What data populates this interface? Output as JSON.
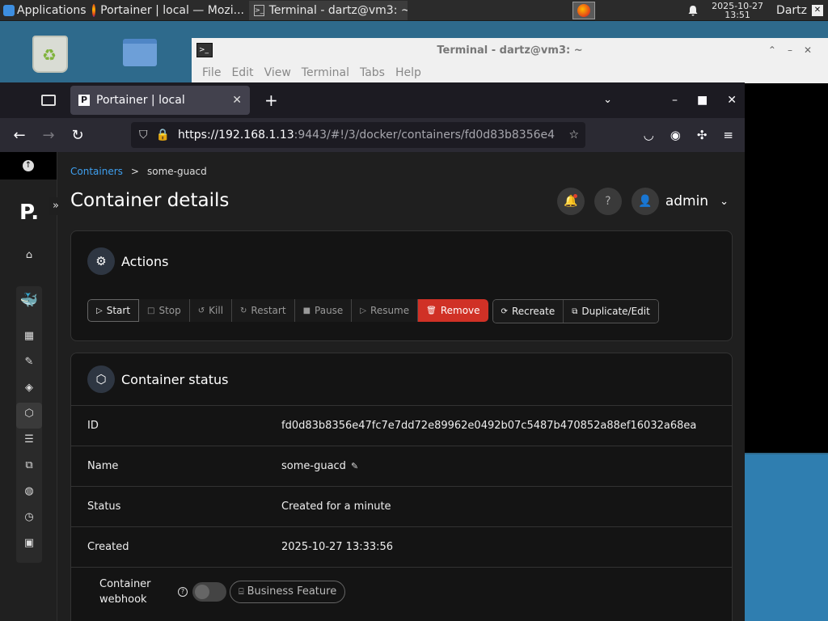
{
  "taskbar": {
    "apps_label": "Applications",
    "tasks": [
      {
        "label": "Portainer | local — Mozi..."
      },
      {
        "label": "Terminal - dartz@vm3: ~"
      }
    ],
    "clock_date": "2025-10-27",
    "clock_time": "13:51",
    "user": "Dartz"
  },
  "terminal": {
    "title": "Terminal - dartz@vm3: ~",
    "menu": [
      "File",
      "Edit",
      "View",
      "Terminal",
      "Tabs",
      "Help"
    ]
  },
  "browser": {
    "tab_title": "Portainer | local",
    "url_host": "https://192.168.1.13",
    "url_rest": ":9443/#!/3/docker/containers/fd0d83b8356e4"
  },
  "page": {
    "breadcrumb_link": "Containers",
    "breadcrumb_sep": ">",
    "breadcrumb_current": "some-guacd",
    "title": "Container details",
    "user": "admin"
  },
  "actions": {
    "title": "Actions",
    "group1": [
      {
        "label": "Start",
        "icon": "play-icon"
      },
      {
        "label": "Stop",
        "icon": "stop-icon"
      },
      {
        "label": "Kill",
        "icon": "kill-icon"
      },
      {
        "label": "Restart",
        "icon": "restart-icon"
      },
      {
        "label": "Pause",
        "icon": "pause-icon"
      },
      {
        "label": "Resume",
        "icon": "play-icon"
      },
      {
        "label": "Remove",
        "icon": "trash-icon"
      }
    ],
    "group2": [
      {
        "label": "Recreate",
        "icon": "refresh-icon"
      },
      {
        "label": "Duplicate/Edit",
        "icon": "copy-icon"
      }
    ]
  },
  "status": {
    "title": "Container status",
    "id_label": "ID",
    "id_value": "fd0d83b8356e47fc7e7dd72e89962e0492b07c5487b470852a88ef16032a68ea",
    "name_label": "Name",
    "name_value": "some-guacd",
    "status_label": "Status",
    "status_value": "Created for a minute",
    "created_label": "Created",
    "created_value": "2025-10-27 13:33:56",
    "webhook_label_1": "Container",
    "webhook_label_2": "webhook",
    "webhook_enabled": false,
    "business_label": "Business Feature"
  },
  "colors": {
    "remove_red": "#d03126",
    "link_blue": "#3ea0f0",
    "docker_blue": "#2496ed"
  }
}
